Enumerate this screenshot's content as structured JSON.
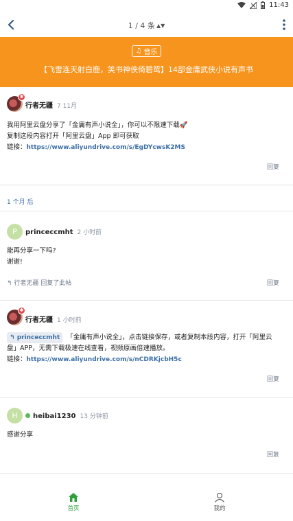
{
  "status_bar": {
    "time": "11:43",
    "icons": [
      "wifi-icon",
      "signal-icon",
      "battery-icon"
    ]
  },
  "topbar": {
    "pager": "1 / 4 条",
    "back_icon": "back-arrow-icon",
    "more_icon": "more-vertical-icon"
  },
  "banner": {
    "tag": "音乐",
    "title": "【飞雪连天射白鹿，笑书神侠倚碧鸳】14部金庸武侠小说有声书",
    "bg_color": "#f7941d"
  },
  "posts": [
    {
      "author": "行者无疆",
      "time": "7 11月",
      "lines": [
        "我用阿里云盘分享了「金庸有声小说全」，你可以不限速下载🚀",
        "复制这段内容打开「阿里云盘」App 即可获取"
      ],
      "link_label": "链接：",
      "link": "https://www.aliyundrive.com/s/EgDYcwsK2MS",
      "reply": "回复"
    },
    {
      "author": "princeccmht",
      "avatar_letter": "P",
      "time": "2 小时前",
      "lines": [
        "能再分享一下吗?",
        "谢谢!"
      ],
      "reply_to": "行者无疆 回复了此帖",
      "reply": "回复"
    },
    {
      "author": "行者无疆",
      "time": "1 小时前",
      "quote": "princeccmht",
      "lines": [
        "「金庸有声小说全」，点击链接保存，或者复制本段内容，打开「阿里云",
        "盘」APP，无需下载极速在线查看，视频原画倍速播放。"
      ],
      "link_label": "链接：",
      "link": "https://www.aliyundrive.com/s/nCDRKjcbH5c",
      "reply": "回复"
    },
    {
      "author": "heibai1230",
      "avatar_letter": "H",
      "time": "13 分钟前",
      "lines": [
        "感谢分享"
      ],
      "reply": "回复"
    }
  ],
  "gap_label": "1 个月 后",
  "bottom_nav": [
    {
      "label": "首页",
      "icon": "home-icon",
      "active": true
    },
    {
      "label": "我的",
      "icon": "user-icon",
      "active": false
    }
  ],
  "colors": {
    "accent": "#f7941d",
    "link": "#3a6ea5",
    "active_nav": "#2e9e3e"
  }
}
